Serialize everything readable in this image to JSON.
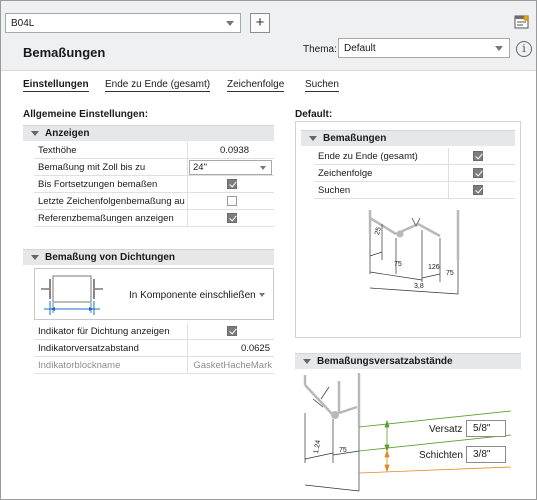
{
  "header": {
    "style_select": "B04L",
    "add_button": "+",
    "title": "Bemaßungen",
    "theme_label": "Thema:",
    "theme_value": "Default"
  },
  "tabs": [
    "Einstellungen",
    "Ende zu Ende (gesamt)",
    "Zeichenfolge",
    "Suchen"
  ],
  "general": {
    "heading": "Allgemeine Einstellungen:",
    "group_title": "Anzeigen",
    "rows": [
      {
        "label": "Texthöhe",
        "value": "0.0938"
      },
      {
        "label": "Bemaßung mit Zoll bis zu",
        "value": "24\""
      },
      {
        "label": "Bis Fortsetzungen bemaßen",
        "checked": true
      },
      {
        "label": "Letzte Zeichenfolgenbemaßung au",
        "checked": false
      },
      {
        "label": "Referenzbemaßungen anzeigen",
        "checked": true
      }
    ]
  },
  "gasket": {
    "group_title": "Bemaßung von Dichtungen",
    "option": "In Komponente einschließen",
    "rows": [
      {
        "label": "Indikator für Dichtung anzeigen",
        "checked": true
      },
      {
        "label": "Indikatorversatzabstand",
        "value": "0.0625"
      },
      {
        "label": "Indikatorblockname",
        "value": "GasketHacheMark"
      }
    ]
  },
  "default": {
    "heading": "Default:",
    "group_title": "Bemaßungen",
    "rows": [
      {
        "label": "Ende zu Ende (gesamt)",
        "checked": true
      },
      {
        "label": "Zeichenfolge",
        "checked": true
      },
      {
        "label": "Suchen",
        "checked": true
      }
    ],
    "diagram": {
      "d1": "25",
      "d2": "75",
      "d3": "126",
      "d4": "75",
      "d5": "3,8"
    }
  },
  "offsets": {
    "group_title": "Bemaßungsversatzabstände",
    "versatz_label": "Versatz",
    "versatz_value": "5/8\"",
    "schichten_label": "Schichten",
    "schichten_value": "3/8\"",
    "diagram": {
      "d1": "1.24",
      "d2": "75"
    }
  }
}
